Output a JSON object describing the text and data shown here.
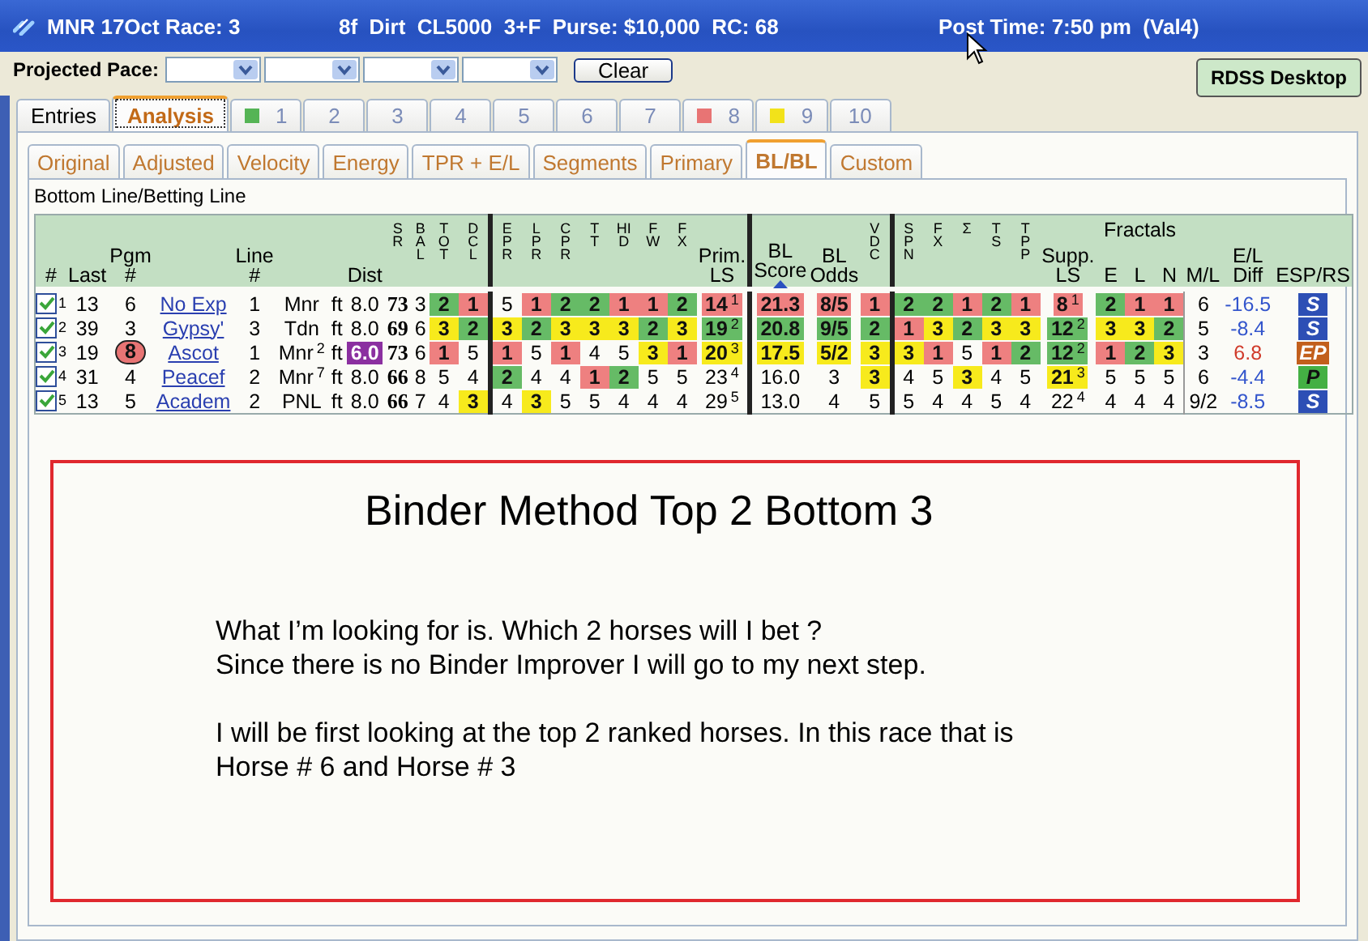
{
  "title_bar": {
    "race": "MNR 17Oct Race: 3",
    "conditions": "8f  Dirt  CL5000  3+F  Purse: $10,000  RC: 68",
    "post_time": "Post Time: 7:50 pm  (Val4)"
  },
  "toolbar": {
    "pace_label": "Projected Pace:",
    "clear_button": "Clear",
    "desktop_button": "RDSS Desktop"
  },
  "main_tabs": [
    {
      "label": "Entries",
      "selected": false
    },
    {
      "label": "Analysis",
      "selected": true
    },
    {
      "label": "1",
      "selected": false,
      "color": "#55b455"
    },
    {
      "label": "2",
      "selected": false
    },
    {
      "label": "3",
      "selected": false
    },
    {
      "label": "4",
      "selected": false
    },
    {
      "label": "5",
      "selected": false
    },
    {
      "label": "6",
      "selected": false
    },
    {
      "label": "7",
      "selected": false
    },
    {
      "label": "8",
      "selected": false,
      "color": "#e87474"
    },
    {
      "label": "9",
      "selected": false,
      "color": "#f2e21a"
    },
    {
      "label": "10",
      "selected": false
    }
  ],
  "view_tabs": [
    {
      "label": "Original",
      "selected": false
    },
    {
      "label": "Adjusted",
      "selected": false
    },
    {
      "label": "Velocity",
      "selected": false
    },
    {
      "label": "Energy",
      "selected": false
    },
    {
      "label": "TPR + E/L",
      "selected": false
    },
    {
      "label": "Segments",
      "selected": false
    },
    {
      "label": "Primary",
      "selected": false
    },
    {
      "label": "BL/BL",
      "selected": true
    },
    {
      "label": "Custom",
      "selected": false
    }
  ],
  "panel_title": "Bottom Line/Betting Line",
  "table": {
    "columns": [
      {
        "label": "#"
      },
      {
        "label": "Last"
      },
      {
        "label": "Pgm #"
      },
      {},
      {
        "label": "Line #"
      },
      {},
      {},
      {
        "label": "Dist"
      },
      {
        "label": "SR"
      },
      {
        "label": "BAL"
      },
      {
        "label": "TOT"
      },
      {
        "label": "DCL"
      },
      {
        "label": "EPR"
      },
      {
        "label": "LPR"
      },
      {
        "label": "CPR"
      },
      {
        "label": "TT"
      },
      {
        "label": "HID"
      },
      {
        "label": "FW"
      },
      {
        "label": "FX"
      },
      {
        "label": "Prim. LS"
      },
      {
        "label": "BL Score",
        "sorted": true
      },
      {
        "label": "BL Odds"
      },
      {
        "label": "VDC"
      },
      {
        "label": "SPN"
      },
      {
        "label": "FX"
      },
      {
        "label": "Σ"
      },
      {
        "label": "TS"
      },
      {
        "label": "TPP"
      },
      {
        "label": "Supp. LS"
      },
      {
        "label": "E"
      },
      {
        "label": "L",
        "group": "Fractals"
      },
      {
        "label": "N"
      },
      {
        "label": "M/L"
      },
      {
        "label": "E/L Diff"
      },
      {
        "label": "ESP/RS"
      }
    ],
    "rows": [
      {
        "cells": [
          {
            "kind": "check",
            "checked": true,
            "text": "1"
          },
          "13",
          "6",
          {
            "kind": "link",
            "text": "No Exp"
          },
          "1",
          "Mnr",
          "ft",
          "8.0",
          "73",
          "3",
          {
            "text": "2",
            "color": "#66bb66"
          },
          {
            "text": "1",
            "color": "#ee8080"
          },
          "5",
          {
            "text": "1",
            "color": "#ee8080"
          },
          {
            "text": "2",
            "color": "#66bb66"
          },
          {
            "text": "2",
            "color": "#66bb66"
          },
          {
            "text": "1",
            "color": "#ee8080"
          },
          {
            "text": "1",
            "color": "#ee8080"
          },
          {
            "text": "2",
            "color": "#66bb66"
          },
          {
            "text": "14",
            "sup": "1",
            "color": "#ee8080"
          },
          {
            "text": "21.3",
            "color": "#ee8080"
          },
          {
            "text": "8/5",
            "color": "#ee8080"
          },
          {
            "text": "1",
            "color": "#ee8080"
          },
          {
            "text": "2",
            "color": "#66bb66"
          },
          {
            "text": "2",
            "color": "#66bb66"
          },
          {
            "text": "1",
            "color": "#ee8080"
          },
          {
            "text": "2",
            "color": "#66bb66"
          },
          {
            "text": "1",
            "color": "#ee8080"
          },
          {
            "text": "8",
            "sup": "1",
            "color": "#ee8080"
          },
          {
            "text": "2",
            "color": "#66bb66"
          },
          {
            "text": "1",
            "color": "#ee8080"
          },
          {
            "text": "1",
            "color": "#ee8080"
          },
          "6",
          {
            "kind": "ink",
            "text": "-16.5",
            "color": "#3355cc"
          },
          {
            "kind": "badge",
            "text": "S",
            "color": "#2d4fb5"
          }
        ]
      },
      {
        "cells": [
          {
            "kind": "check",
            "checked": true,
            "text": "2"
          },
          "39",
          "3",
          {
            "kind": "link",
            "text": "Gypsy'"
          },
          "3",
          "Tdn",
          "ft",
          "8.0",
          "69",
          "6",
          {
            "text": "3",
            "color": "#f7ea1c"
          },
          {
            "text": "2",
            "color": "#66bb66"
          },
          {
            "text": "3",
            "color": "#f7ea1c"
          },
          {
            "text": "2",
            "color": "#66bb66"
          },
          {
            "text": "3",
            "color": "#f7ea1c"
          },
          {
            "text": "3",
            "color": "#f7ea1c"
          },
          {
            "text": "3",
            "color": "#f7ea1c"
          },
          {
            "text": "2",
            "color": "#66bb66"
          },
          {
            "text": "3",
            "color": "#f7ea1c"
          },
          {
            "text": "19",
            "sup": "2",
            "color": "#66bb66"
          },
          {
            "text": "20.8",
            "color": "#66bb66"
          },
          {
            "text": "9/5",
            "color": "#66bb66"
          },
          {
            "text": "2",
            "color": "#66bb66"
          },
          {
            "text": "1",
            "color": "#ee8080"
          },
          {
            "text": "3",
            "color": "#f7ea1c"
          },
          {
            "text": "2",
            "color": "#66bb66"
          },
          {
            "text": "3",
            "color": "#f7ea1c"
          },
          {
            "text": "3",
            "color": "#f7ea1c"
          },
          {
            "text": "12",
            "sup": "2",
            "color": "#66bb66"
          },
          {
            "text": "3",
            "color": "#f7ea1c"
          },
          {
            "text": "3",
            "color": "#f7ea1c"
          },
          {
            "text": "2",
            "color": "#66bb66"
          },
          "5",
          {
            "kind": "ink",
            "text": "-8.4",
            "color": "#3355cc"
          },
          {
            "kind": "badge",
            "text": "S",
            "color": "#2d4fb5"
          }
        ]
      },
      {
        "cells": [
          {
            "kind": "check",
            "checked": true,
            "text": "3"
          },
          "19",
          {
            "kind": "pill",
            "text": "8",
            "color": "#e87474"
          },
          {
            "kind": "link",
            "text": "Ascot"
          },
          "1",
          {
            "text": "Mnr",
            "sup": "2"
          },
          "ft",
          {
            "text": "6.0",
            "color": "#8b2fa0"
          },
          "73",
          "6",
          {
            "text": "1",
            "color": "#ee8080"
          },
          "5",
          {
            "text": "1",
            "color": "#ee8080"
          },
          "5",
          {
            "text": "1",
            "color": "#ee8080"
          },
          "4",
          "5",
          {
            "text": "3",
            "color": "#f7ea1c"
          },
          {
            "text": "1",
            "color": "#ee8080"
          },
          {
            "text": "20",
            "sup": "3",
            "color": "#f7ea1c"
          },
          {
            "text": "17.5",
            "color": "#f7ea1c"
          },
          {
            "text": "5/2",
            "color": "#f7ea1c"
          },
          {
            "text": "3",
            "color": "#f7ea1c"
          },
          {
            "text": "3",
            "color": "#f7ea1c"
          },
          {
            "text": "1",
            "color": "#ee8080"
          },
          "5",
          {
            "text": "1",
            "color": "#ee8080"
          },
          {
            "text": "2",
            "color": "#66bb66"
          },
          {
            "text": "12",
            "sup": "2",
            "color": "#66bb66"
          },
          {
            "text": "1",
            "color": "#ee8080"
          },
          {
            "text": "2",
            "color": "#66bb66"
          },
          {
            "text": "3",
            "color": "#f7ea1c"
          },
          "3",
          {
            "kind": "ink",
            "text": "6.8",
            "color": "#d03a2a"
          },
          {
            "kind": "badge",
            "text": "EP",
            "color": "#c25f1c"
          }
        ]
      },
      {
        "cells": [
          {
            "kind": "check",
            "checked": true,
            "text": "4"
          },
          "31",
          "4",
          {
            "kind": "link",
            "text": "Peacef"
          },
          "2",
          {
            "text": "Mnr",
            "sup": "7"
          },
          "ft",
          "8.0",
          "66",
          "8",
          "5",
          "4",
          {
            "text": "2",
            "color": "#66bb66"
          },
          "4",
          "4",
          {
            "text": "1",
            "color": "#ee8080"
          },
          {
            "text": "2",
            "color": "#66bb66"
          },
          "5",
          "5",
          {
            "text": "23",
            "sup": "4"
          },
          "16.0",
          "3",
          {
            "text": "3",
            "color": "#f7ea1c"
          },
          "4",
          "5",
          {
            "text": "3",
            "color": "#f7ea1c"
          },
          "4",
          "5",
          {
            "text": "21",
            "sup": "3",
            "color": "#f7ea1c"
          },
          "5",
          "5",
          "5",
          "6",
          {
            "kind": "ink",
            "text": "-4.4",
            "color": "#3355cc"
          },
          {
            "kind": "badge",
            "text": "P",
            "color": "#44b044"
          }
        ]
      },
      {
        "cells": [
          {
            "kind": "check",
            "checked": true,
            "text": "5"
          },
          "13",
          "5",
          {
            "kind": "link",
            "text": "Academ"
          },
          "2",
          "PNL",
          "ft",
          "8.0",
          "66",
          "7",
          "4",
          {
            "text": "3",
            "color": "#f7ea1c"
          },
          "4",
          {
            "text": "3",
            "color": "#f7ea1c"
          },
          "5",
          "5",
          "4",
          "4",
          "4",
          {
            "text": "29",
            "sup": "5"
          },
          "13.0",
          "4",
          "5",
          "5",
          "4",
          "4",
          "5",
          "4",
          {
            "text": "22",
            "sup": "4"
          },
          "4",
          "4",
          "4",
          "9/2",
          {
            "kind": "ink",
            "text": "-8.5",
            "color": "#3355cc"
          },
          {
            "kind": "badge",
            "text": "S",
            "color": "#2d4fb5"
          }
        ]
      }
    ]
  },
  "note": {
    "title": "Binder  Method  Top 2  Bottom 3",
    "paragraphs": [
      [
        "What I’m looking for is. Which 2 horses will I bet ?",
        "Since there is no Binder Improver  I will go to my next step."
      ],
      [
        "I will be first looking at the top 2 ranked horses.  In this race that is",
        "Horse # 6 and Horse # 3"
      ]
    ]
  }
}
